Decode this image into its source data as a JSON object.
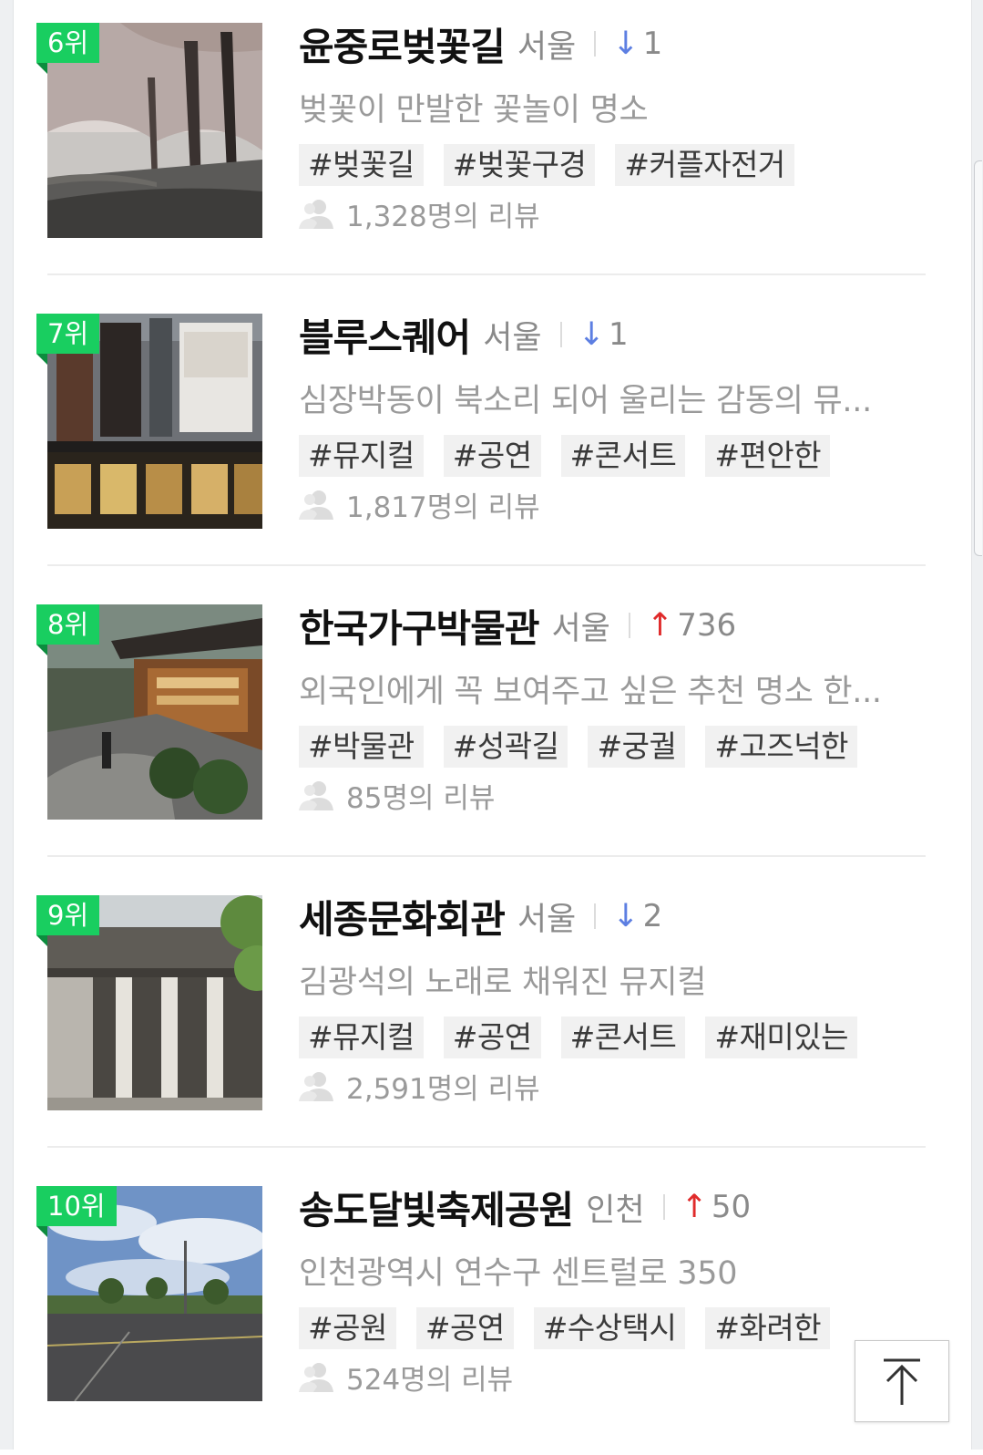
{
  "items": [
    {
      "rank": "6위",
      "name": "윤중로벚꽃길",
      "region": "서울",
      "change_arrow": "↓",
      "change_value": "1",
      "change_direction": "down",
      "description": "벚꽃이 만발한 꽃놀이 명소",
      "tags": [
        "#벚꽃길",
        "#벚꽃구경",
        "#커플자전거"
      ],
      "reviews": "1,328명의 리뷰",
      "thumbnail_icon": "cherry-blossom-road-photo"
    },
    {
      "rank": "7위",
      "name": "블루스퀘어",
      "region": "서울",
      "change_arrow": "↓",
      "change_value": "1",
      "change_direction": "down",
      "description": "심장박동이 북소리 되어 울리는 감동의 뮤...",
      "tags": [
        "#뮤지컬",
        "#공연",
        "#콘서트",
        "#편안한"
      ],
      "reviews": "1,817명의 리뷰",
      "thumbnail_icon": "theater-building-photo"
    },
    {
      "rank": "8위",
      "name": "한국가구박물관",
      "region": "서울",
      "change_arrow": "↑",
      "change_value": "736",
      "change_direction": "up",
      "description": "외국인에게 꼭 보여주고 싶은 추천 명소 한...",
      "tags": [
        "#박물관",
        "#성곽길",
        "#궁궐",
        "#고즈넉한"
      ],
      "reviews": "85명의 리뷰",
      "thumbnail_icon": "museum-hanok-photo"
    },
    {
      "rank": "9위",
      "name": "세종문화회관",
      "region": "서울",
      "change_arrow": "↓",
      "change_value": "2",
      "change_direction": "down",
      "description": "김광석의 노래로 채워진 뮤지컬",
      "tags": [
        "#뮤지컬",
        "#공연",
        "#콘서트",
        "#재미있는"
      ],
      "reviews": "2,591명의 리뷰",
      "thumbnail_icon": "sejong-center-columns-photo"
    },
    {
      "rank": "10위",
      "name": "송도달빛축제공원",
      "region": "인천",
      "change_arrow": "↑",
      "change_value": "50",
      "change_direction": "up",
      "description": "인천광역시 연수구 센트럴로 350",
      "tags": [
        "#공원",
        "#공연",
        "#수상택시",
        "#화려한"
      ],
      "reviews": "524명의 리뷰",
      "thumbnail_icon": "park-sky-photo"
    }
  ],
  "colors": {
    "rank_badge": "#19ce60",
    "arrow_down": "#5d7fe2",
    "arrow_up": "#e02b2b"
  },
  "icons": {
    "reviews": "person-icon",
    "back_to_top": "arrow-up-to-top-icon"
  }
}
